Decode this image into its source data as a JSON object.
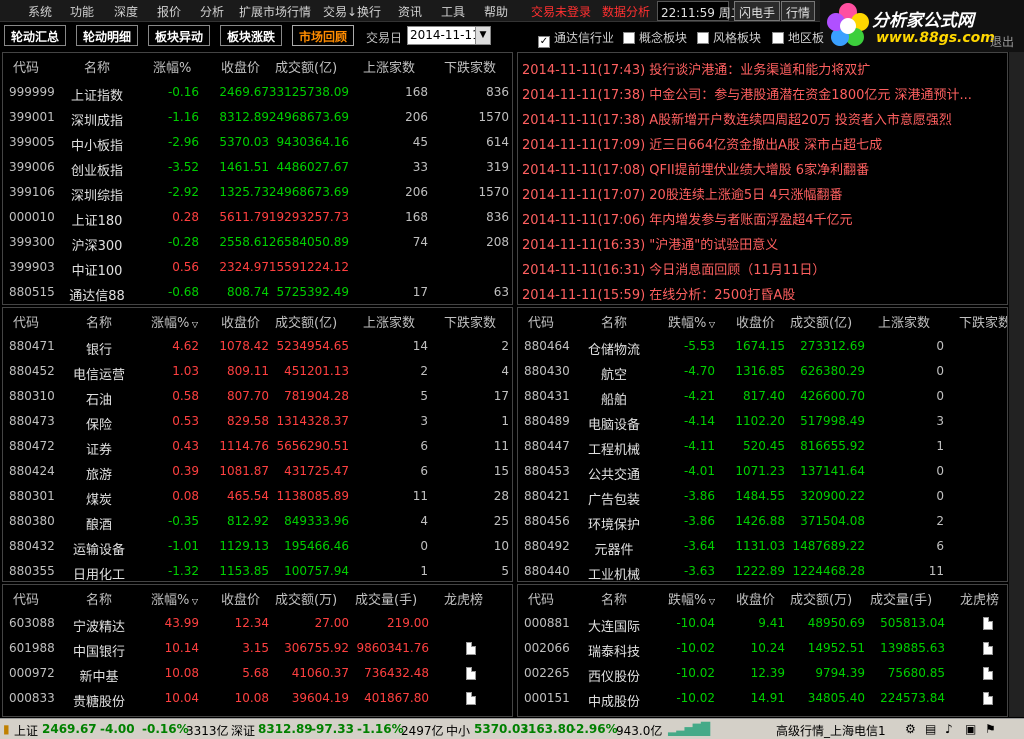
{
  "menu": [
    "系统",
    "功能",
    "深度",
    "报价",
    "分析",
    "扩展市场行情",
    "交易↓换行",
    "资讯",
    "工具",
    "帮助"
  ],
  "menu_red": [
    "交易未登录",
    "数据分析"
  ],
  "clock": "22:11:59 周二",
  "top_buttons": [
    "闪电手",
    "行情"
  ],
  "logo": {
    "title": "分析家公式网",
    "url": "www.88gs.com",
    "exit": "退出"
  },
  "tabs": [
    "轮动汇总",
    "轮动明细",
    "板块异动",
    "板块涨跌",
    "市场回顾"
  ],
  "date_label": "交易日",
  "date_value": "2014-11-11",
  "checkboxes": [
    {
      "label": "通达信行业",
      "checked": true
    },
    {
      "label": "概念板块",
      "checked": false
    },
    {
      "label": "风格板块",
      "checked": false
    },
    {
      "label": "地区板",
      "checked": false
    }
  ],
  "index_headers": [
    "代码",
    "名称",
    "涨幅%",
    "收盘价",
    "成交额(亿)",
    "上涨家数",
    "下跌家数"
  ],
  "index_rows": [
    [
      "999999",
      "上证指数",
      "-0.16",
      "2469.67",
      "33125738.09",
      "168",
      "836"
    ],
    [
      "399001",
      "深圳成指",
      "-1.16",
      "8312.89",
      "24968673.69",
      "206",
      "1570"
    ],
    [
      "399005",
      "中小板指",
      "-2.96",
      "5370.03",
      "9430364.16",
      "45",
      "614"
    ],
    [
      "399006",
      "创业板指",
      "-3.52",
      "1461.51",
      "4486027.67",
      "33",
      "319"
    ],
    [
      "399106",
      "深圳综指",
      "-2.92",
      "1325.73",
      "24968673.69",
      "206",
      "1570"
    ],
    [
      "000010",
      "上证180",
      "0.28",
      "5611.79",
      "19293257.73",
      "168",
      "836"
    ],
    [
      "399300",
      "沪深300",
      "-0.28",
      "2558.61",
      "26584050.89",
      "74",
      "208"
    ],
    [
      "399903",
      "中证100",
      "0.56",
      "2324.97",
      "15591224.12",
      "",
      ""
    ],
    [
      "880515",
      "通达信88",
      "-0.68",
      "808.74",
      "5725392.49",
      "17",
      "63"
    ]
  ],
  "news": [
    "2014-11-11(17:43) 投行谈沪港通：业务渠道和能力将双扩",
    "2014-11-11(17:38) 中金公司：参与港股通潜在资金1800亿元 深港通预计...",
    "2014-11-11(17:38) A股新增开户数连续四周超20万 投资者入市意愿强烈",
    "2014-11-11(17:09) 近三日664亿资金撤出A股 深市占超七成",
    "2014-11-11(17:08) QFII提前埋伏业绩大增股 6家净利翻番",
    "2014-11-11(17:07) 20股连续上涨逾5日 4只涨幅翻番",
    "2014-11-11(17:06) 年内增发参与者账面浮盈超4千亿元",
    "2014-11-11(16:33) \"沪港通\"的试验田意义",
    "2014-11-11(16:31) 今日消息面回顾（11月11日）",
    "2014-11-11(15:59) 在线分析：2500打昏A股"
  ],
  "sector_up_headers": [
    "代码",
    "名称",
    "涨幅%",
    "收盘价",
    "成交额(亿)",
    "上涨家数",
    "下跌家数"
  ],
  "sector_up_rows": [
    [
      "880471",
      "银行",
      "4.62",
      "1078.42",
      "5234954.65",
      "14",
      "2"
    ],
    [
      "880452",
      "电信运营",
      "1.03",
      "809.11",
      "451201.13",
      "2",
      "4"
    ],
    [
      "880310",
      "石油",
      "0.58",
      "807.70",
      "781904.28",
      "5",
      "17"
    ],
    [
      "880473",
      "保险",
      "0.53",
      "829.58",
      "1314328.37",
      "3",
      "1"
    ],
    [
      "880472",
      "证券",
      "0.43",
      "1114.76",
      "5656290.51",
      "6",
      "11"
    ],
    [
      "880424",
      "旅游",
      "0.39",
      "1081.87",
      "431725.47",
      "6",
      "15"
    ],
    [
      "880301",
      "煤炭",
      "0.08",
      "465.54",
      "1138085.89",
      "11",
      "28"
    ],
    [
      "880380",
      "酿酒",
      "-0.35",
      "812.92",
      "849333.96",
      "4",
      "25"
    ],
    [
      "880432",
      "运输设备",
      "-1.01",
      "1129.13",
      "195466.46",
      "0",
      "10"
    ],
    [
      "880355",
      "日用化工",
      "-1.32",
      "1153.85",
      "100757.94",
      "1",
      "5"
    ]
  ],
  "sector_dn_headers": [
    "代码",
    "名称",
    "跌幅%",
    "收盘价",
    "成交额(亿)",
    "上涨家数",
    "下跌家数"
  ],
  "sector_dn_rows": [
    [
      "880464",
      "仓储物流",
      "-5.53",
      "1674.15",
      "273312.69",
      "0",
      ""
    ],
    [
      "880430",
      "航空",
      "-4.70",
      "1316.85",
      "626380.29",
      "0",
      ""
    ],
    [
      "880431",
      "船舶",
      "-4.21",
      "817.40",
      "426600.70",
      "0",
      ""
    ],
    [
      "880489",
      "电脑设备",
      "-4.14",
      "1102.20",
      "517998.49",
      "3",
      ""
    ],
    [
      "880447",
      "工程机械",
      "-4.11",
      "520.45",
      "816655.92",
      "1",
      ""
    ],
    [
      "880453",
      "公共交通",
      "-4.01",
      "1071.23",
      "137141.64",
      "0",
      ""
    ],
    [
      "880421",
      "广告包装",
      "-3.86",
      "1484.55",
      "320900.22",
      "0",
      ""
    ],
    [
      "880456",
      "环境保护",
      "-3.86",
      "1426.88",
      "371504.08",
      "2",
      ""
    ],
    [
      "880492",
      "元器件",
      "-3.64",
      "1131.03",
      "1487689.22",
      "6",
      ""
    ],
    [
      "880440",
      "工业机械",
      "-3.63",
      "1222.89",
      "1224468.28",
      "11",
      ""
    ]
  ],
  "stock_up_headers": [
    "代码",
    "名称",
    "涨幅%",
    "收盘价",
    "成交额(万)",
    "成交量(手)",
    "龙虎榜"
  ],
  "stock_up_rows": [
    [
      "603088",
      "宁波精达",
      "43.99",
      "12.34",
      "27.00",
      "219.00",
      false
    ],
    [
      "601988",
      "中国银行",
      "10.14",
      "3.15",
      "306755.92",
      "9860341.76",
      true
    ],
    [
      "000972",
      "新中基",
      "10.08",
      "5.68",
      "41060.37",
      "736432.48",
      true
    ],
    [
      "000833",
      "贵糖股份",
      "10.04",
      "10.08",
      "39604.19",
      "401867.80",
      true
    ]
  ],
  "stock_dn_headers": [
    "代码",
    "名称",
    "跌幅%",
    "收盘价",
    "成交额(万)",
    "成交量(手)",
    "龙虎榜"
  ],
  "stock_dn_rows": [
    [
      "000881",
      "大连国际",
      "-10.04",
      "9.41",
      "48950.69",
      "505813.04",
      true
    ],
    [
      "002066",
      "瑞泰科技",
      "-10.02",
      "10.24",
      "14952.51",
      "139885.63",
      true
    ],
    [
      "002265",
      "西仪股份",
      "-10.02",
      "12.39",
      "9794.39",
      "75680.85",
      true
    ],
    [
      "000151",
      "中成股份",
      "-10.02",
      "14.91",
      "34805.40",
      "224573.84",
      true
    ]
  ],
  "status": {
    "sh_label": "上证",
    "sh_val": "2469.67",
    "sh_chg": "-4.00",
    "sh_pct": "-0.16%",
    "sh_amt": "3313亿",
    "sz_label": "深证",
    "sz_val": "8312.89",
    "sz_chg": "-97.33",
    "sz_pct": "-1.16%",
    "sz_amt": "2497亿",
    "zx_label": "中小",
    "zx_val": "5370.03",
    "zx_chg": "-163.80",
    "zx_pct": "-2.96%",
    "zx_amt": "943.0亿",
    "server": "高级行情_上海电信1"
  }
}
